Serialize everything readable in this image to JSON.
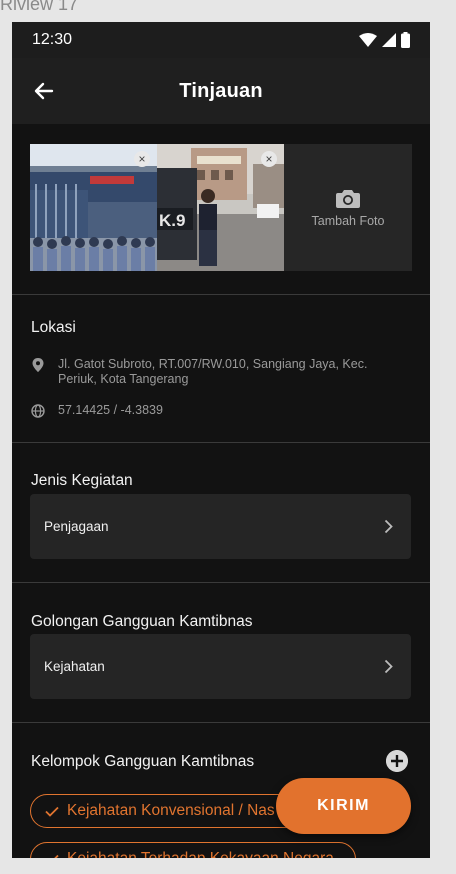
{
  "frame_label": "Riview 17",
  "status_bar": {
    "time": "12:30"
  },
  "app_bar": {
    "title": "Tinjauan",
    "back_icon": "arrow-left-icon"
  },
  "photos": {
    "items": [
      {
        "name": "photo-police-formation",
        "remove_icon": "close-icon"
      },
      {
        "name": "photo-police-street",
        "remove_icon": "close-icon"
      }
    ],
    "add_label": "Tambah Foto",
    "add_icon": "camera-icon"
  },
  "location": {
    "title": "Lokasi",
    "address": "Jl. Gatot Subroto, RT.007/RW.010, Sangiang Jaya, Kec. Periuk, Kota Tangerang",
    "address_icon": "map-pin-icon",
    "coordinates": "57.14425 / -4.3839",
    "coordinates_icon": "globe-icon"
  },
  "jenis_kegiatan": {
    "title": "Jenis Kegiatan",
    "value": "Penjagaan"
  },
  "golongan": {
    "title": "Golongan Gangguan Kamtibnas",
    "value": "Kejahatan"
  },
  "kelompok": {
    "title": "Kelompok Gangguan Kamtibnas",
    "add_icon": "plus-circle-icon",
    "chips": [
      {
        "label": "Kejahatan Konvensional / Nas"
      },
      {
        "label": "Kejahatan Terhadap Kekayaan Negara"
      }
    ]
  },
  "submit": {
    "label": "KIRIM"
  },
  "colors": {
    "accent": "#e2722d",
    "background": "#121212",
    "surface": "#252525"
  }
}
